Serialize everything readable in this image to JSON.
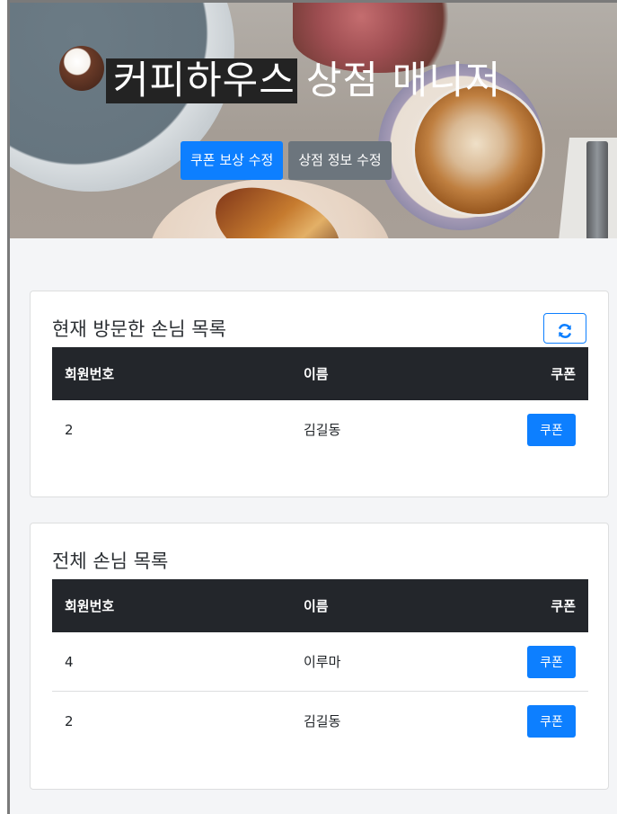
{
  "hero": {
    "title_part1": "커피하우스",
    "title_part2": "상점 매니저",
    "buttons": {
      "edit_coupon_reward": "쿠폰 보상 수정",
      "edit_store_info": "상점 정보 수정"
    }
  },
  "current_visitors": {
    "title": "현재 방문한 손님 목록",
    "refresh_icon": "refresh-icon",
    "columns": [
      "회원번호",
      "이름",
      "쿠폰"
    ],
    "rows": [
      {
        "member_id": "2",
        "name": "김길동",
        "coupon_label": "쿠폰"
      }
    ]
  },
  "all_customers": {
    "title": "전체 손님 목록",
    "columns": [
      "회원번호",
      "이름",
      "쿠폰"
    ],
    "rows": [
      {
        "member_id": "4",
        "name": "이루마",
        "coupon_label": "쿠폰"
      },
      {
        "member_id": "2",
        "name": "김길동",
        "coupon_label": "쿠폰"
      }
    ]
  },
  "colors": {
    "primary": "#0d7fff",
    "secondary": "#6c757d",
    "table_header": "#23262b"
  }
}
